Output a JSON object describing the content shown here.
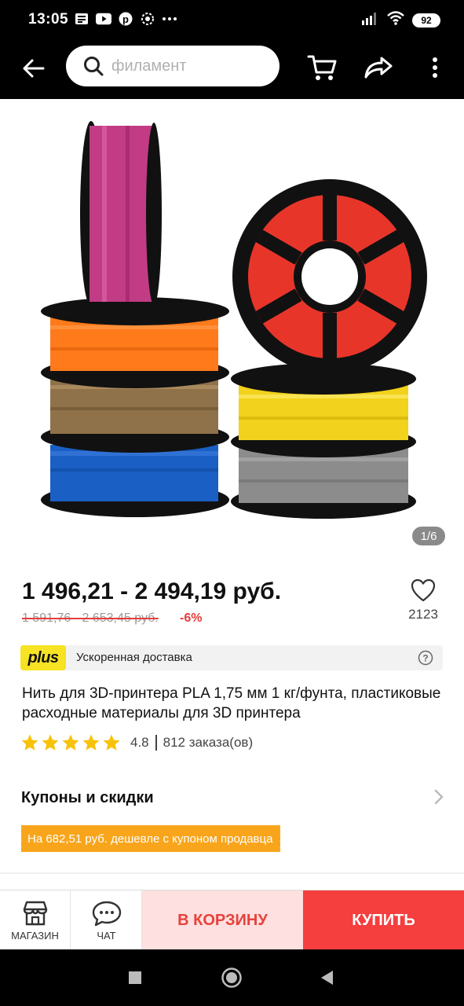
{
  "status_bar": {
    "time": "13:05",
    "battery": "92",
    "notification_icons": [
      "news-icon",
      "youtube-icon",
      "pinterest-icon",
      "settings-badge-icon",
      "more-dots-icon"
    ]
  },
  "top_bar": {
    "search_placeholder": "филамент",
    "icons": [
      "back-arrow-icon",
      "search-icon",
      "cart-icon",
      "share-icon",
      "overflow-menu-icon"
    ]
  },
  "gallery": {
    "counter": "1/6"
  },
  "price": {
    "current": "1 496,21 - 2 494,19 руб.",
    "old": "1 591,76 - 2 653,45 руб.",
    "discount": "-6%"
  },
  "wishlist": {
    "count": "2123"
  },
  "plus_bar": {
    "logo": "plus",
    "text": "Ускоренная доставка"
  },
  "product": {
    "title": "Нить для 3D-принтера PLA 1,75 мм 1 кг/фунта, пластиковые расходные материалы для 3D принтера",
    "rating": "4.8",
    "orders": "812 заказа(ов)",
    "stars": 5
  },
  "coupons": {
    "title": "Купоны и скидки",
    "badge": "На 682,51 руб. дешевле с купоном продавца"
  },
  "action_bar": {
    "store_label": "МАГАЗИН",
    "chat_label": "ЧАТ",
    "cart_label": "В КОРЗИНУ",
    "buy_label": "КУПИТЬ"
  },
  "colors": {
    "accent_red": "#f53e3e",
    "cart_bg": "#fde0df",
    "coupon_orange": "#f8a51c",
    "plus_yellow": "#f7e224",
    "star_yellow": "#f9c20a"
  }
}
